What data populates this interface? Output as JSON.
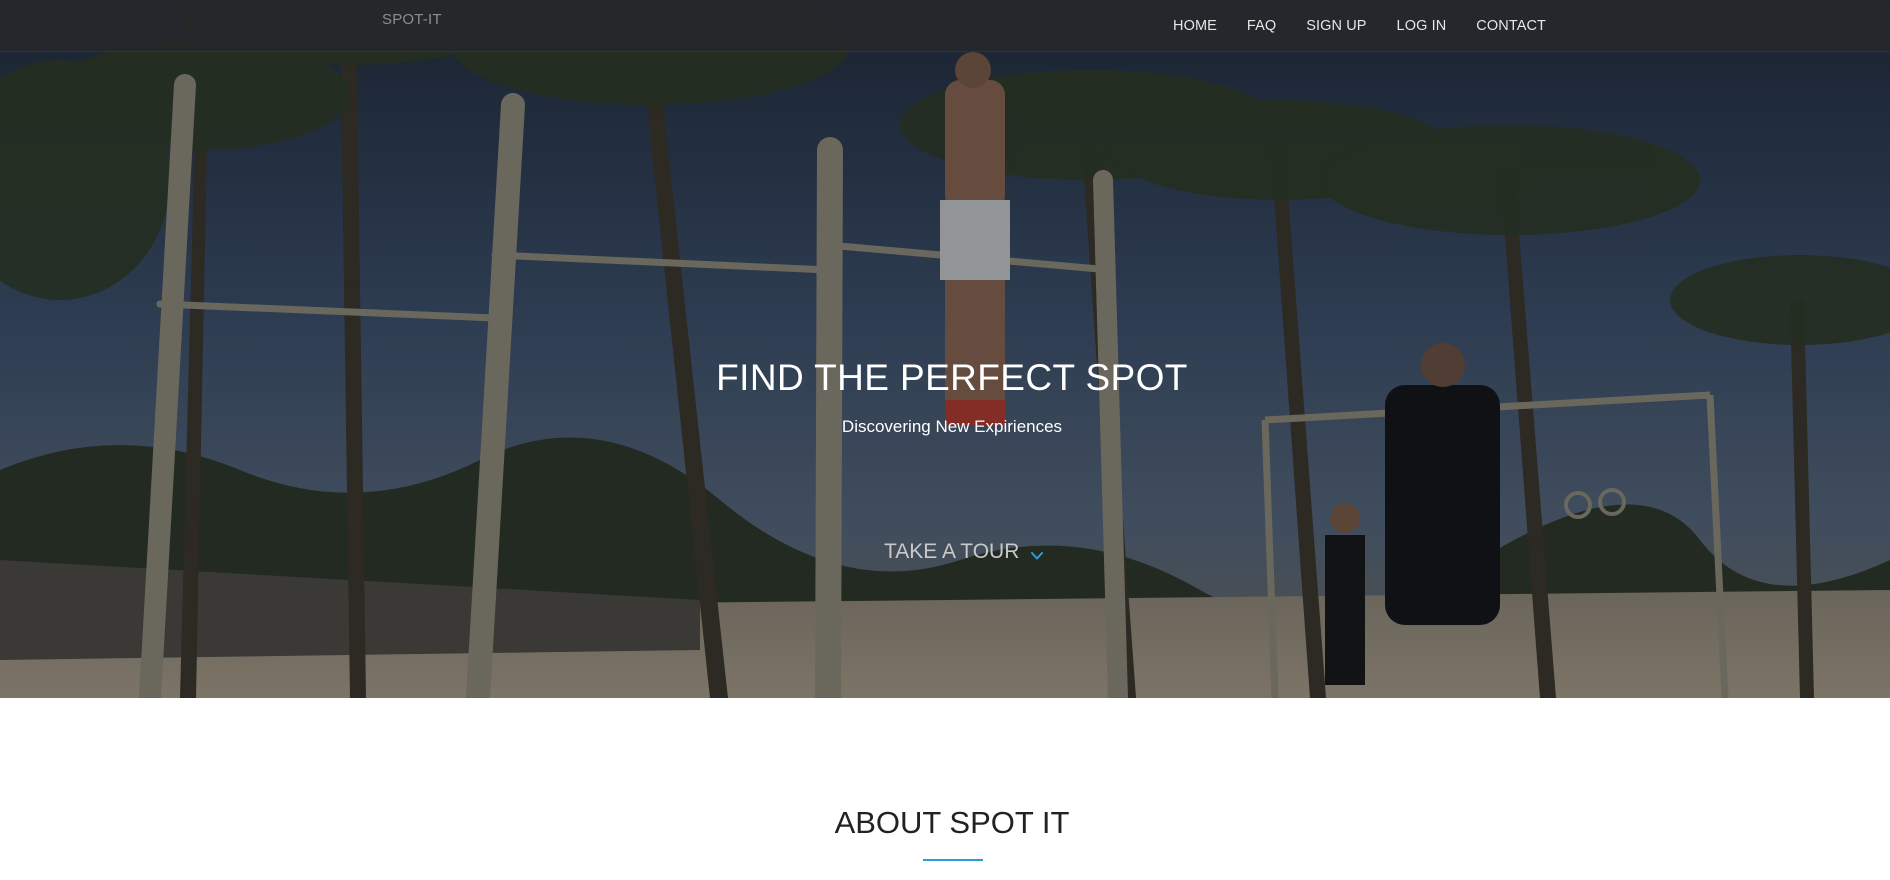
{
  "nav": {
    "brand": "SPOT-IT",
    "links": [
      {
        "label": "HOME"
      },
      {
        "label": "FAQ"
      },
      {
        "label": "SIGN UP"
      },
      {
        "label": "LOG IN"
      },
      {
        "label": "CONTACT"
      }
    ]
  },
  "hero": {
    "title": "FIND THE PERFECT SPOT",
    "subtitle": "Discovering New Expiriences",
    "tour_label": "TAKE A TOUR",
    "tour_icon": "chevron-down-icon",
    "background": "beach-calisthenics-park-photo"
  },
  "about": {
    "heading": "ABOUT SPOT IT"
  },
  "colors": {
    "accent": "#2a9fd6",
    "navbar_bg": "#26282a",
    "hero_text": "#ffffff"
  }
}
